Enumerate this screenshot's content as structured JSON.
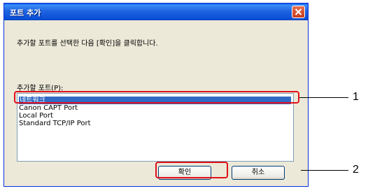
{
  "dialog": {
    "title": "포트 추가",
    "instruction": "추가할 포트를 선택한 다음 [확인]을 클릭합니다.",
    "list_label": "추가할 포트(P):",
    "ports": [
      "네트워크",
      "Canon CAPT Port",
      "Local Port",
      "Standard TCP/IP Port"
    ],
    "selected_port": "네트워크",
    "ok_label": "확인",
    "cancel_label": "취소"
  },
  "callouts": {
    "one": "1",
    "two": "2"
  },
  "colors": {
    "titlebar": "#0a5fe6",
    "selection": "#316ac5",
    "callout": "#e0101a"
  }
}
